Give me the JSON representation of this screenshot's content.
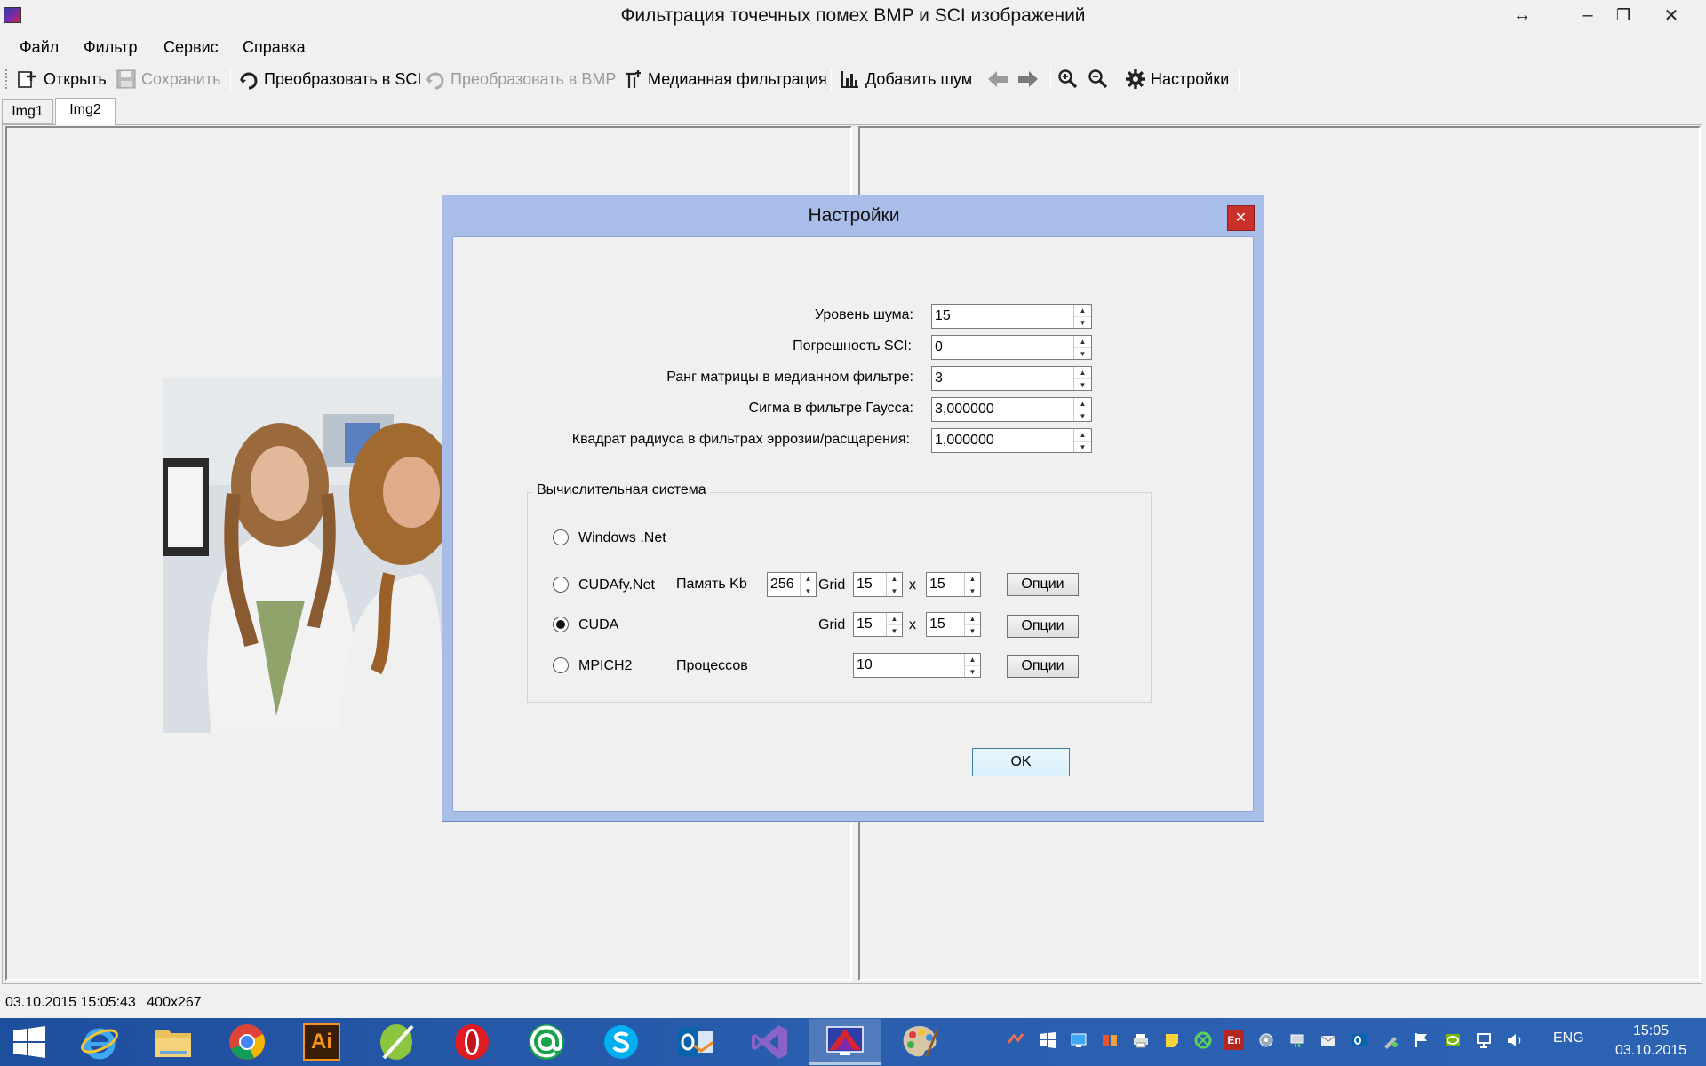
{
  "window": {
    "title": "Фильтрация точечных помех BMP и SCI изображений",
    "resize_glyph": "↔",
    "minimize_glyph": "–",
    "maximize_glyph": "❐",
    "close_glyph": "✕"
  },
  "menu": [
    "Файл",
    "Фильтр",
    "Сервис",
    "Справка"
  ],
  "toolbar": {
    "open": "Открыть",
    "save": "Сохранить",
    "to_sci": "Преобразовать в SCI",
    "to_bmp": "Преобразовать в BMP",
    "median": "Медианная фильтрация",
    "add_noise": "Добавить шум",
    "settings": "Настройки"
  },
  "tabs": [
    "Img1",
    "Img2"
  ],
  "status": {
    "datetime": "03.10.2015 15:05:43",
    "size": "400x267"
  },
  "dialog": {
    "title": "Настройки",
    "close_glyph": "✕",
    "fields": [
      {
        "label": "Уровень шума:",
        "value": "15"
      },
      {
        "label": "Погрешность SCI:",
        "value": "0"
      },
      {
        "label": "Ранг матрицы в медианном фильтре:",
        "value": "3"
      },
      {
        "label": "Сигма в фильтре Гаусса:",
        "value": "3,000000"
      },
      {
        "label": "Квадрат радиуса в фильтрах эррозии/расщарения:",
        "value": "1,000000"
      }
    ],
    "group_title": "Вычислительная система",
    "systems": [
      {
        "label": "Windows .Net",
        "selected": false
      },
      {
        "label": "CUDAfy.Net",
        "selected": false
      },
      {
        "label": "CUDA",
        "selected": true
      },
      {
        "label": "MPICH2",
        "selected": false
      }
    ],
    "memory_label": "Память Kb",
    "memory_value": "256",
    "grid_label": "Grid",
    "times": "x",
    "cudafy_grid": [
      "15",
      "15"
    ],
    "cuda_grid": [
      "15",
      "15"
    ],
    "processes_label": "Процессов",
    "processes_value": "10",
    "options_label": "Опции",
    "ok_label": "OK"
  },
  "taskbar": {
    "apps": [
      "start",
      "internet-explorer",
      "file-explorer",
      "chrome",
      "illustrator",
      "coreldraw",
      "opera",
      "mail-agent",
      "skype",
      "outlook",
      "visual-studio",
      "filter-app",
      "paint"
    ],
    "illustrator_text": "Ai",
    "lang": "ENG",
    "en_badge": "En",
    "time": "15:05",
    "date": "03.10.2015"
  }
}
